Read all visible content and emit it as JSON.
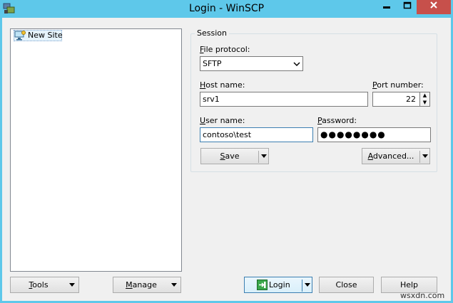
{
  "window": {
    "title": "Login - WinSCP",
    "minimize_glyph": "▬",
    "maximize_glyph": "☐",
    "close_glyph": "✕"
  },
  "site_tree": {
    "items": [
      {
        "label": "New Site",
        "icon": "computer-icon"
      }
    ]
  },
  "session": {
    "legend": "Session",
    "file_protocol": {
      "label_prefix": "",
      "label_accel": "F",
      "label_rest": "ile protocol:",
      "value": "SFTP"
    },
    "host_name": {
      "label_accel": "H",
      "label_rest": "ost name:",
      "value": "srv1"
    },
    "port_number": {
      "label_accel": "P",
      "label_rest": "ort number:",
      "value": "22"
    },
    "user_name": {
      "label_accel": "U",
      "label_rest": "ser name:",
      "value": "contoso\\test"
    },
    "password": {
      "label_accel": "P",
      "label_rest": "assword:",
      "value": "●●●●●●●●"
    },
    "save_button": {
      "accel": "S",
      "rest": "ave"
    },
    "advanced_button": {
      "accel": "A",
      "rest": "dvanced..."
    }
  },
  "footer": {
    "tools": {
      "accel": "T",
      "rest": "ools"
    },
    "manage": {
      "accel": "M",
      "rest": "anage"
    },
    "login": {
      "accel": "",
      "rest": "Login"
    },
    "close": {
      "label": "Close"
    },
    "help": {
      "label": "Help"
    }
  },
  "watermark": "wsxdn.com",
  "colors": {
    "title_bar": "#5ec8ea",
    "close_button": "#c7504b",
    "focus_border": "#3c7fb1"
  }
}
